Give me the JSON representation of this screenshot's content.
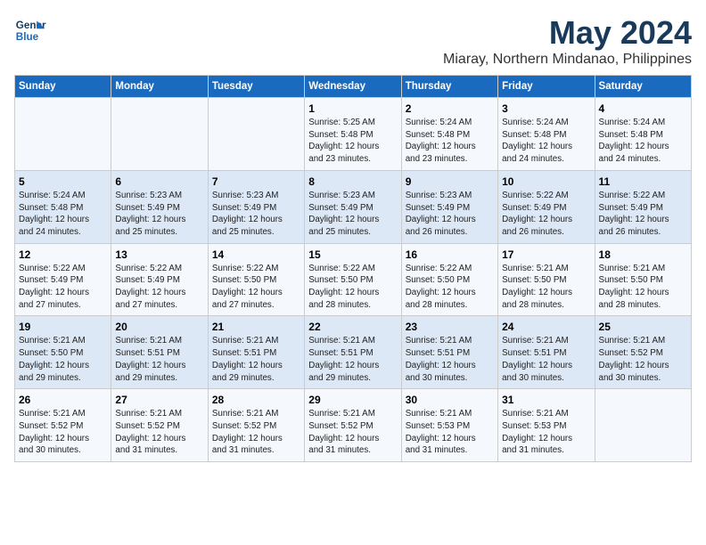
{
  "header": {
    "logo_line1": "General",
    "logo_line2": "Blue",
    "title": "May 2024",
    "subtitle": "Miaray, Northern Mindanao, Philippines"
  },
  "days_of_week": [
    "Sunday",
    "Monday",
    "Tuesday",
    "Wednesday",
    "Thursday",
    "Friday",
    "Saturday"
  ],
  "weeks": [
    [
      {
        "day": "",
        "info": ""
      },
      {
        "day": "",
        "info": ""
      },
      {
        "day": "",
        "info": ""
      },
      {
        "day": "1",
        "info": "Sunrise: 5:25 AM\nSunset: 5:48 PM\nDaylight: 12 hours\nand 23 minutes."
      },
      {
        "day": "2",
        "info": "Sunrise: 5:24 AM\nSunset: 5:48 PM\nDaylight: 12 hours\nand 23 minutes."
      },
      {
        "day": "3",
        "info": "Sunrise: 5:24 AM\nSunset: 5:48 PM\nDaylight: 12 hours\nand 24 minutes."
      },
      {
        "day": "4",
        "info": "Sunrise: 5:24 AM\nSunset: 5:48 PM\nDaylight: 12 hours\nand 24 minutes."
      }
    ],
    [
      {
        "day": "5",
        "info": "Sunrise: 5:24 AM\nSunset: 5:48 PM\nDaylight: 12 hours\nand 24 minutes."
      },
      {
        "day": "6",
        "info": "Sunrise: 5:23 AM\nSunset: 5:49 PM\nDaylight: 12 hours\nand 25 minutes."
      },
      {
        "day": "7",
        "info": "Sunrise: 5:23 AM\nSunset: 5:49 PM\nDaylight: 12 hours\nand 25 minutes."
      },
      {
        "day": "8",
        "info": "Sunrise: 5:23 AM\nSunset: 5:49 PM\nDaylight: 12 hours\nand 25 minutes."
      },
      {
        "day": "9",
        "info": "Sunrise: 5:23 AM\nSunset: 5:49 PM\nDaylight: 12 hours\nand 26 minutes."
      },
      {
        "day": "10",
        "info": "Sunrise: 5:22 AM\nSunset: 5:49 PM\nDaylight: 12 hours\nand 26 minutes."
      },
      {
        "day": "11",
        "info": "Sunrise: 5:22 AM\nSunset: 5:49 PM\nDaylight: 12 hours\nand 26 minutes."
      }
    ],
    [
      {
        "day": "12",
        "info": "Sunrise: 5:22 AM\nSunset: 5:49 PM\nDaylight: 12 hours\nand 27 minutes."
      },
      {
        "day": "13",
        "info": "Sunrise: 5:22 AM\nSunset: 5:49 PM\nDaylight: 12 hours\nand 27 minutes."
      },
      {
        "day": "14",
        "info": "Sunrise: 5:22 AM\nSunset: 5:50 PM\nDaylight: 12 hours\nand 27 minutes."
      },
      {
        "day": "15",
        "info": "Sunrise: 5:22 AM\nSunset: 5:50 PM\nDaylight: 12 hours\nand 28 minutes."
      },
      {
        "day": "16",
        "info": "Sunrise: 5:22 AM\nSunset: 5:50 PM\nDaylight: 12 hours\nand 28 minutes."
      },
      {
        "day": "17",
        "info": "Sunrise: 5:21 AM\nSunset: 5:50 PM\nDaylight: 12 hours\nand 28 minutes."
      },
      {
        "day": "18",
        "info": "Sunrise: 5:21 AM\nSunset: 5:50 PM\nDaylight: 12 hours\nand 28 minutes."
      }
    ],
    [
      {
        "day": "19",
        "info": "Sunrise: 5:21 AM\nSunset: 5:50 PM\nDaylight: 12 hours\nand 29 minutes."
      },
      {
        "day": "20",
        "info": "Sunrise: 5:21 AM\nSunset: 5:51 PM\nDaylight: 12 hours\nand 29 minutes."
      },
      {
        "day": "21",
        "info": "Sunrise: 5:21 AM\nSunset: 5:51 PM\nDaylight: 12 hours\nand 29 minutes."
      },
      {
        "day": "22",
        "info": "Sunrise: 5:21 AM\nSunset: 5:51 PM\nDaylight: 12 hours\nand 29 minutes."
      },
      {
        "day": "23",
        "info": "Sunrise: 5:21 AM\nSunset: 5:51 PM\nDaylight: 12 hours\nand 30 minutes."
      },
      {
        "day": "24",
        "info": "Sunrise: 5:21 AM\nSunset: 5:51 PM\nDaylight: 12 hours\nand 30 minutes."
      },
      {
        "day": "25",
        "info": "Sunrise: 5:21 AM\nSunset: 5:52 PM\nDaylight: 12 hours\nand 30 minutes."
      }
    ],
    [
      {
        "day": "26",
        "info": "Sunrise: 5:21 AM\nSunset: 5:52 PM\nDaylight: 12 hours\nand 30 minutes."
      },
      {
        "day": "27",
        "info": "Sunrise: 5:21 AM\nSunset: 5:52 PM\nDaylight: 12 hours\nand 31 minutes."
      },
      {
        "day": "28",
        "info": "Sunrise: 5:21 AM\nSunset: 5:52 PM\nDaylight: 12 hours\nand 31 minutes."
      },
      {
        "day": "29",
        "info": "Sunrise: 5:21 AM\nSunset: 5:52 PM\nDaylight: 12 hours\nand 31 minutes."
      },
      {
        "day": "30",
        "info": "Sunrise: 5:21 AM\nSunset: 5:53 PM\nDaylight: 12 hours\nand 31 minutes."
      },
      {
        "day": "31",
        "info": "Sunrise: 5:21 AM\nSunset: 5:53 PM\nDaylight: 12 hours\nand 31 minutes."
      },
      {
        "day": "",
        "info": ""
      }
    ]
  ]
}
